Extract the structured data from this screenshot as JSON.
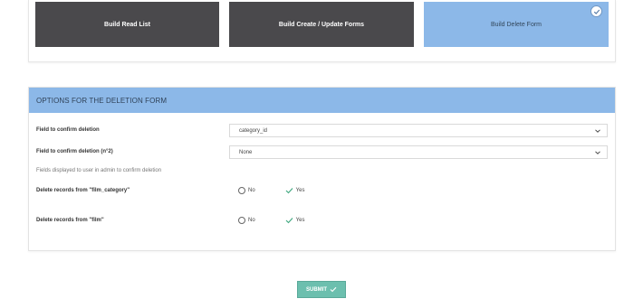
{
  "build_buttons": {
    "read_list": "Build Read List",
    "create_update": "Build Create / Update Forms",
    "delete_form": "Build Delete Form"
  },
  "options": {
    "header": "OPTIONS FOR THE DELETION FORM",
    "field_confirm_label": "Field to confirm deletion",
    "field_confirm_value": "category_id",
    "field_confirm2_label": "Field to confirm deletion (n°2)",
    "field_confirm2_value": "None",
    "help_text": "Fields displayed to user in admin to confirm deletion",
    "delete_records": [
      {
        "label": "Delete records from \"film_category\"",
        "no_label": "No",
        "yes_label": "Yes",
        "selected": "Yes"
      },
      {
        "label": "Delete records from \"film\"",
        "no_label": "No",
        "yes_label": "Yes",
        "selected": "Yes"
      }
    ]
  },
  "submit": {
    "label": "SUBMIT"
  },
  "colors": {
    "dark_button": "#4a494c",
    "active_button": "#8cb8e8",
    "header_bg": "#8cb8e8",
    "submit_bg": "#6cbfae",
    "check_green": "#3aa57c"
  }
}
